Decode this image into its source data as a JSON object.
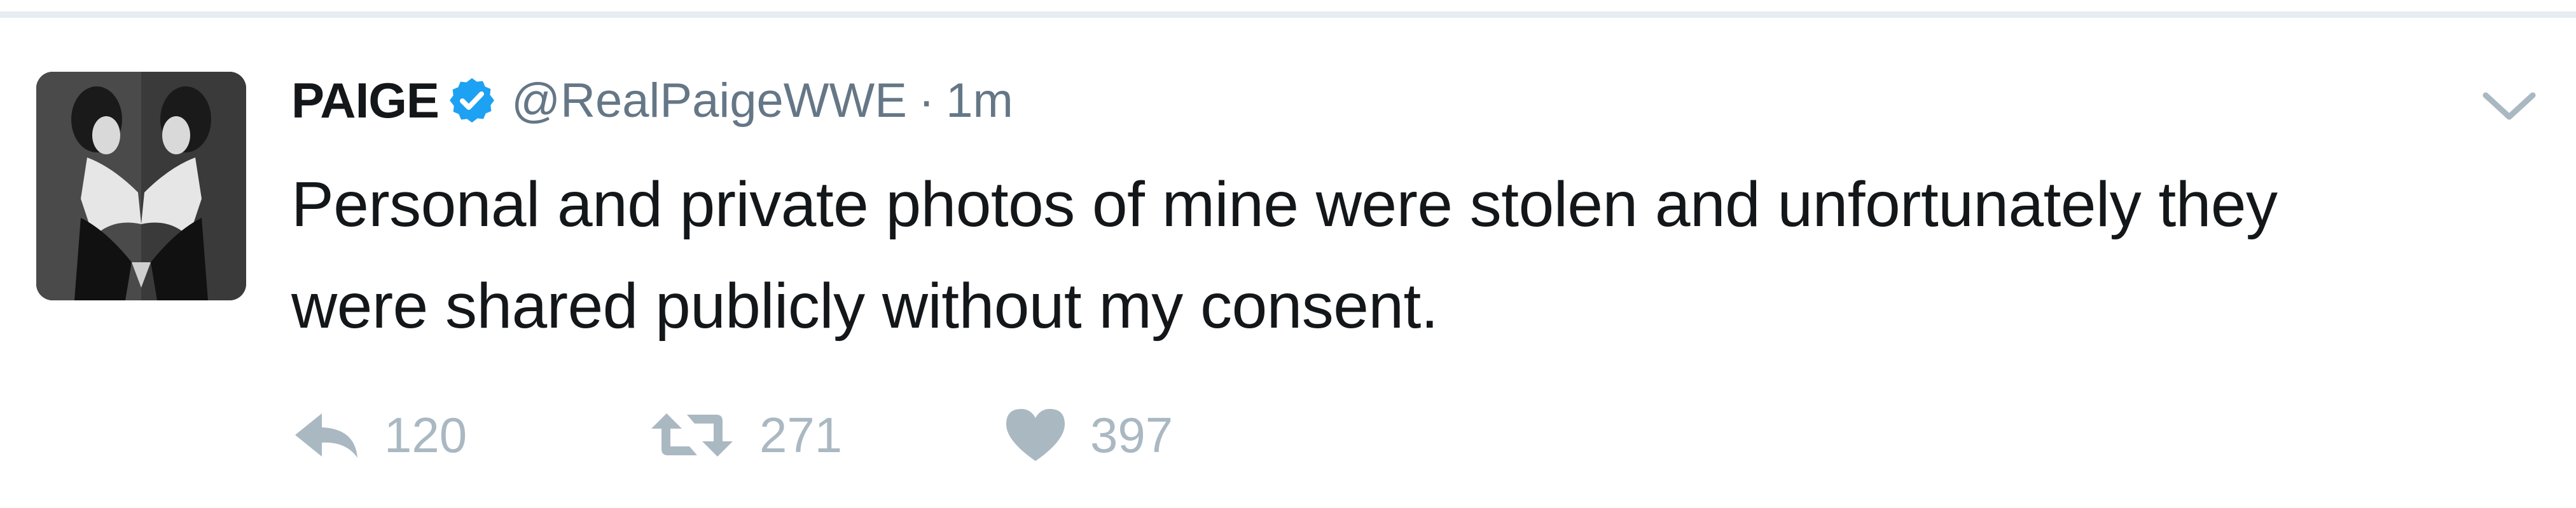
{
  "tweet": {
    "display_name": "PAIGE",
    "handle": "@RealPaigeWWE",
    "separator": "·",
    "timestamp": "1m",
    "text_lines": [
      "Personal and private photos of mine were stolen and unfortunately they",
      "were shared publicly without my consent."
    ],
    "verified": true,
    "actions": {
      "reply_count": "120",
      "retweet_count": "271",
      "like_count": "397"
    }
  },
  "icons": {
    "verified": "verified-badge-icon",
    "more": "chevron-down-icon",
    "reply": "reply-arrow-icon",
    "retweet": "retweet-icon",
    "like": "heart-icon"
  },
  "colors": {
    "verified_blue": "#1da1f2",
    "text": "#14171a",
    "secondary_text": "#657786",
    "action_gray": "#aab8c2",
    "divider": "#e6ecf0"
  }
}
